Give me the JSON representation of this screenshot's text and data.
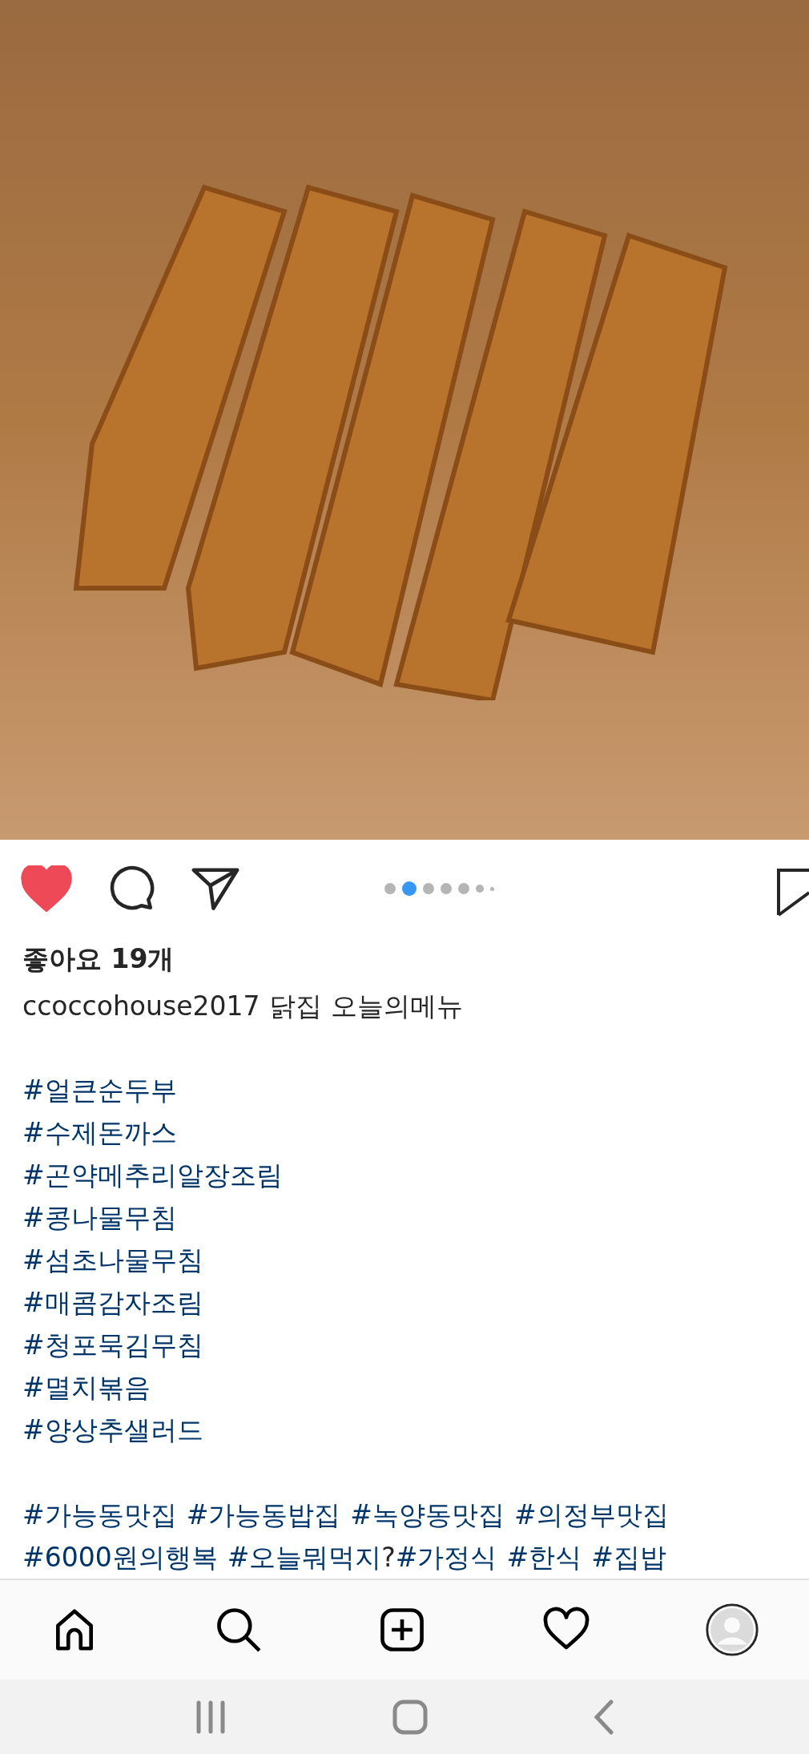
{
  "post": {
    "liked": true,
    "carousel_dots": [
      {
        "selected": false,
        "kind": "large"
      },
      {
        "selected": true,
        "kind": "large"
      },
      {
        "selected": false,
        "kind": "large"
      },
      {
        "selected": false,
        "kind": "large"
      },
      {
        "selected": false,
        "kind": "large"
      },
      {
        "selected": false,
        "kind": "medium"
      },
      {
        "selected": false,
        "kind": "small"
      }
    ],
    "likes": "좋아요 19개",
    "username": "ccoccohouse2017",
    "caption": "닭집 오늘의메뉴",
    "hashtag_lines": [
      [
        {
          "kind": "tag",
          "text": "#얼큰순두부"
        }
      ],
      [
        {
          "kind": "tag",
          "text": "#수제돈까스"
        }
      ],
      [
        {
          "kind": "tag",
          "text": "#곤약메추리알장조림"
        }
      ],
      [
        {
          "kind": "tag",
          "text": "#콩나물무침"
        }
      ],
      [
        {
          "kind": "tag",
          "text": "#섬초나물무침"
        }
      ],
      [
        {
          "kind": "tag",
          "text": "#매콤감자조림"
        }
      ],
      [
        {
          "kind": "tag",
          "text": "#청포묵김무침"
        }
      ],
      [
        {
          "kind": "tag",
          "text": "#멸치볶음"
        }
      ],
      [
        {
          "kind": "tag",
          "text": "#양상추샐러드"
        }
      ]
    ],
    "tag_lines": [
      [
        {
          "kind": "tag",
          "text": "#가능동맛집"
        },
        {
          "kind": "tag",
          "text": "#가능동밥집"
        },
        {
          "kind": "tag",
          "text": "#녹양동맛집"
        },
        {
          "kind": "tag",
          "text": "#의정부맛집"
        }
      ],
      [
        {
          "kind": "tag",
          "text": "#6000원의행복"
        },
        {
          "kind": "tag",
          "text": "#오늘뭐먹지"
        },
        {
          "kind": "text",
          "text": "?"
        },
        {
          "kind": "tag",
          "text": "#가정식"
        },
        {
          "kind": "tag",
          "text": "#한식"
        },
        {
          "kind": "tag",
          "text": "#집밥"
        }
      ]
    ]
  },
  "bottom_nav": [
    {
      "kind": "home"
    },
    {
      "kind": "search"
    },
    {
      "kind": "add"
    },
    {
      "kind": "activity"
    },
    {
      "kind": "profile"
    }
  ]
}
